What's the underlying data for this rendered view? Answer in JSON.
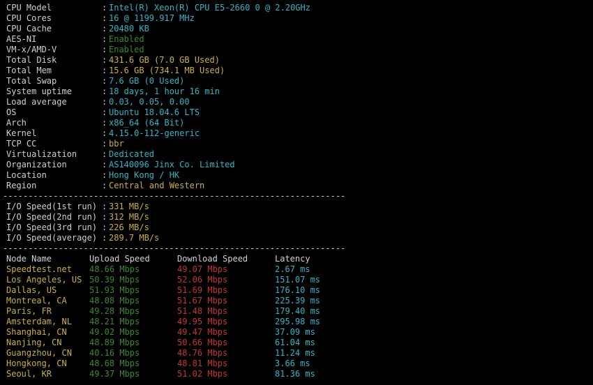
{
  "colors": {
    "cyan": "#2cb7c8",
    "yellow": "#c9b23a",
    "green": "#3a8a2a",
    "red": "#c63232",
    "white": "#d0d0d0"
  },
  "sysinfo": [
    {
      "label": "CPU Model",
      "value": "Intel(R) Xeon(R) CPU E5-2660 0 @ 2.20GHz"
    },
    {
      "label": "CPU Cores",
      "value": "16 @ 1199.917 MHz"
    },
    {
      "label": "CPU Cache",
      "value": "20480 KB"
    },
    {
      "label": "AES-NI",
      "value": "Enabled"
    },
    {
      "label": "VM-x/AMD-V",
      "value": "Enabled"
    },
    {
      "label": "Total Disk",
      "value": "431.6 GB (7.0 GB Used)"
    },
    {
      "label": "Total Mem",
      "value": "15.6 GB (734.1 MB Used)"
    },
    {
      "label": "Total Swap",
      "value": "7.6 GB (0 Used)"
    },
    {
      "label": "System uptime",
      "value": "18 days, 1 hour 16 min"
    },
    {
      "label": "Load average",
      "value": "0.03, 0.05, 0.00"
    },
    {
      "label": "OS",
      "value": "Ubuntu 18.04.6 LTS"
    },
    {
      "label": "Arch",
      "value": "x86_64 (64 Bit)"
    },
    {
      "label": "Kernel",
      "value": "4.15.0-112-generic"
    },
    {
      "label": "TCP CC",
      "value": "bbr"
    },
    {
      "label": "Virtualization",
      "value": "Dedicated"
    },
    {
      "label": "Organization",
      "value": "AS140096 Jinx Co. Limited"
    },
    {
      "label": "Location",
      "value": "Hong Kong / HK"
    },
    {
      "label": "Region",
      "value": "Central and Western"
    }
  ],
  "separator": "--------------------------------------------------------------------",
  "io": [
    {
      "label": "I/O Speed(1st run)",
      "value": "331 MB/s"
    },
    {
      "label": "I/O Speed(2nd run)",
      "value": "312 MB/s"
    },
    {
      "label": "I/O Speed(3rd run)",
      "value": "226 MB/s"
    },
    {
      "label": "I/O Speed(average)",
      "value": "289.7 MB/s"
    }
  ],
  "speed_headers": {
    "node": "Node Name",
    "upload": "Upload Speed",
    "download": "Download Speed",
    "latency": "Latency"
  },
  "speed": [
    {
      "node": "Speedtest.net",
      "upload": "48.66 Mbps",
      "download": "49.07 Mbps",
      "latency": "2.67 ms"
    },
    {
      "node": "Los Angeles, US",
      "upload": "50.39 Mbps",
      "download": "52.06 Mbps",
      "latency": "151.07 ms"
    },
    {
      "node": "Dallas, US",
      "upload": "51.93 Mbps",
      "download": "51.69 Mbps",
      "latency": "176.10 ms"
    },
    {
      "node": "Montreal, CA",
      "upload": "48.08 Mbps",
      "download": "51.67 Mbps",
      "latency": "225.39 ms"
    },
    {
      "node": "Paris, FR",
      "upload": "49.28 Mbps",
      "download": "51.48 Mbps",
      "latency": "179.40 ms"
    },
    {
      "node": "Amsterdam, NL",
      "upload": "48.21 Mbps",
      "download": "49.95 Mbps",
      "latency": "295.98 ms"
    },
    {
      "node": "Shanghai, CN",
      "upload": "49.02 Mbps",
      "download": "49.47 Mbps",
      "latency": "37.09 ms"
    },
    {
      "node": "Nanjing, CN",
      "upload": "48.89 Mbps",
      "download": "50.66 Mbps",
      "latency": "61.04 ms"
    },
    {
      "node": "Guangzhou, CN",
      "upload": "40.16 Mbps",
      "download": "48.76 Mbps",
      "latency": "11.24 ms"
    },
    {
      "node": "Hongkong, CN",
      "upload": "48.68 Mbps",
      "download": "48.81 Mbps",
      "latency": "3.66 ms"
    },
    {
      "node": "Seoul, KR",
      "upload": "49.37 Mbps",
      "download": "51.02 Mbps",
      "latency": "81.36 ms"
    }
  ]
}
